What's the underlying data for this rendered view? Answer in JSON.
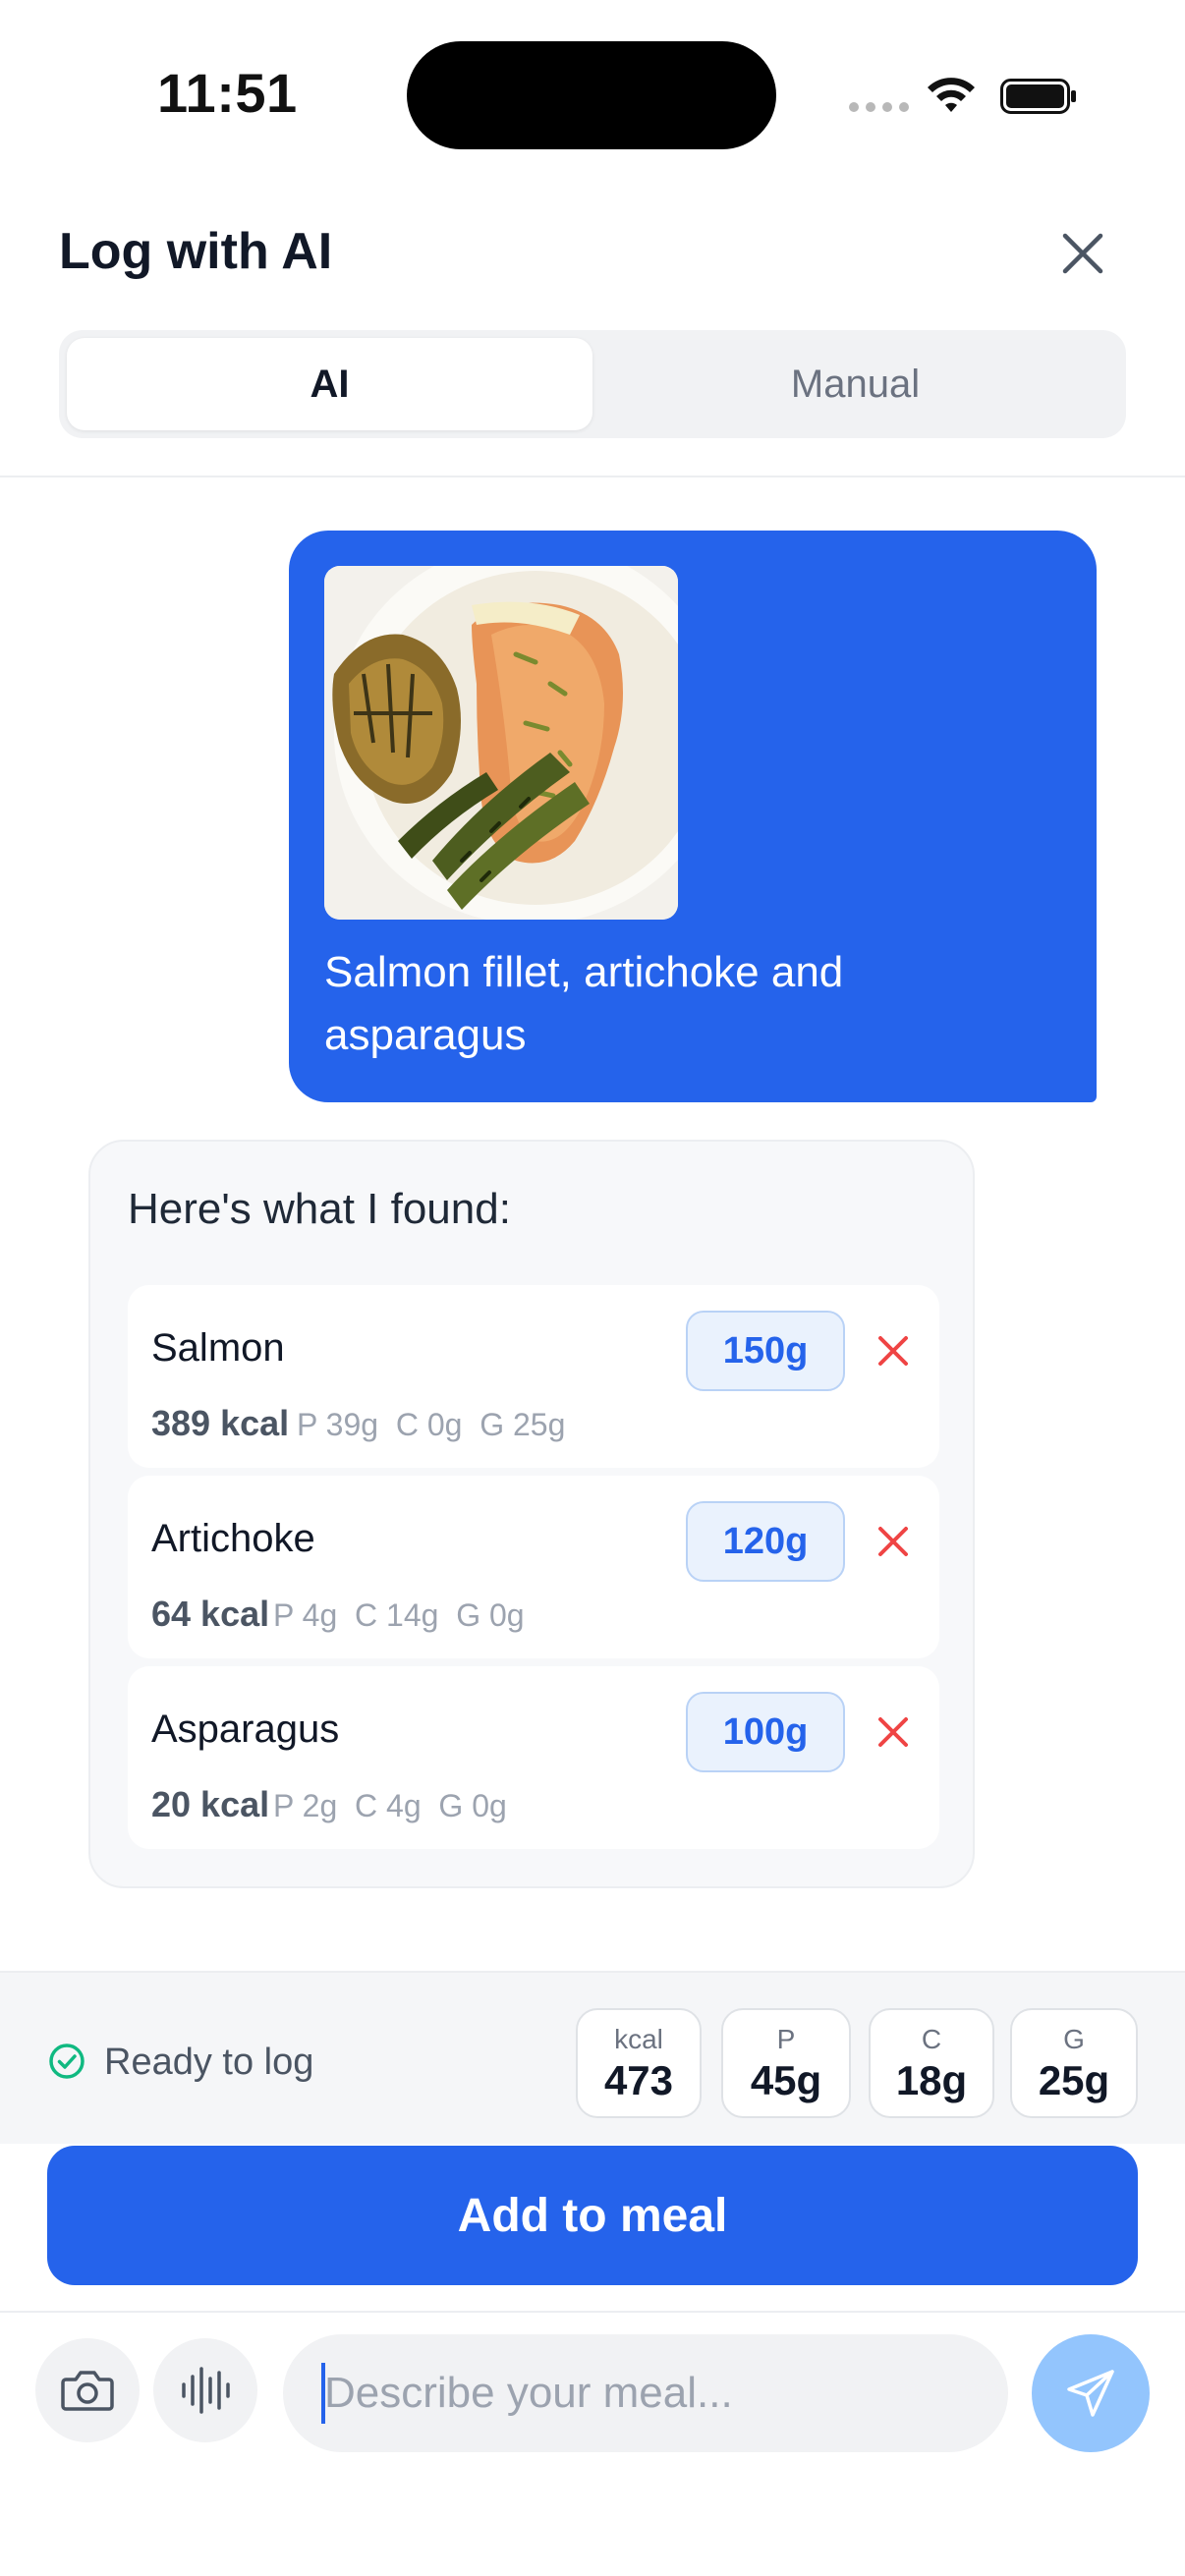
{
  "status_bar": {
    "time": "11:51"
  },
  "header": {
    "title": "Log with AI",
    "close_icon": "close-icon"
  },
  "tabs": [
    {
      "label": "AI",
      "active": true
    },
    {
      "label": "Manual",
      "active": false
    }
  ],
  "user_message": {
    "text": "Salmon fillet, artichoke and asparagus",
    "image_icon": "meal-photo"
  },
  "ai_response": {
    "heading": "Here's what I found:",
    "items": [
      {
        "name": "Salmon",
        "grams": "150g",
        "kcal": "389 kcal",
        "macros": "P 39g  C 0g  G 25g"
      },
      {
        "name": "Artichoke",
        "grams": "120g",
        "kcal": "64 kcal",
        "macros": "P 4g  C 14g  G 0g"
      },
      {
        "name": "Asparagus",
        "grams": "100g",
        "kcal": "20 kcal",
        "macros": "P 2g  C 4g  G 0g"
      }
    ]
  },
  "summary": {
    "status": "Ready to log",
    "stats": [
      {
        "label": "kcal",
        "value": "473"
      },
      {
        "label": "P",
        "value": "45g"
      },
      {
        "label": "C",
        "value": "18g"
      },
      {
        "label": "G",
        "value": "25g"
      }
    ]
  },
  "add_button": {
    "label": "Add to meal"
  },
  "composer": {
    "placeholder": "Describe your meal..."
  },
  "colors": {
    "accent": "#2563eb",
    "remove": "#ef4444",
    "ready": "#10b981",
    "send_disabled": "#93c5fd"
  }
}
